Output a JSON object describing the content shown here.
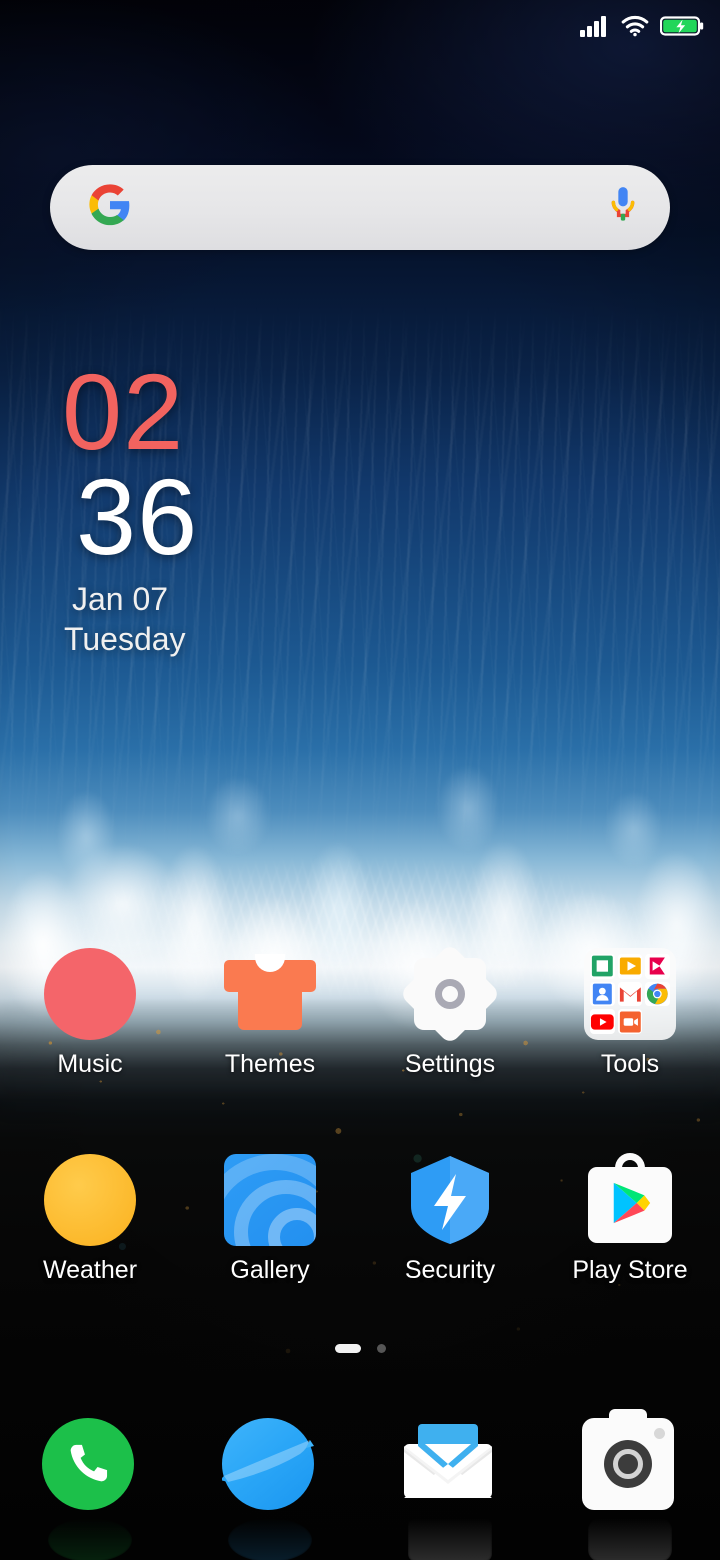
{
  "status_bar": {
    "signal_icon": "cellular-signal-icon",
    "signal_bars": 4,
    "wifi_icon": "wifi-icon",
    "battery_icon": "battery-charging-icon",
    "battery_color": "#22d65a",
    "charging": true
  },
  "search": {
    "google_logo": "google-g-icon",
    "query": "",
    "placeholder": "",
    "mic_icon": "microphone-icon"
  },
  "clock_widget": {
    "hours": "02",
    "minutes": "36",
    "date": "Jan 07",
    "weekday": "Tuesday",
    "hours_color": "#f2635f",
    "minutes_color": "#ffffff"
  },
  "home_grid": {
    "rows": [
      {
        "apps": [
          {
            "label": "Music",
            "icon": "music-note-icon",
            "color": "#f4656a"
          },
          {
            "label": "Themes",
            "icon": "tshirt-icon",
            "color": "#fa7a50"
          },
          {
            "label": "Settings",
            "icon": "gear-icon",
            "color": "#fafafa"
          },
          {
            "label": "Tools",
            "icon": "folder-icon",
            "color": "#fafafa"
          }
        ]
      },
      {
        "apps": [
          {
            "label": "Weather",
            "icon": "sun-icon",
            "color": "#fcb92c"
          },
          {
            "label": "Gallery",
            "icon": "photos-icon",
            "color": "#2e9cf5"
          },
          {
            "label": "Security",
            "icon": "shield-bolt-icon",
            "color": "#2e9cf5"
          },
          {
            "label": "Play Store",
            "icon": "play-store-icon",
            "color": "#ffffff"
          }
        ]
      }
    ]
  },
  "tools_folder": {
    "label": "Tools",
    "mini_apps": [
      {
        "icon": "sheets-icon",
        "color": "#21a366"
      },
      {
        "icon": "play-movies-icon",
        "color": "#f9ab00"
      },
      {
        "icon": "play-music-icon",
        "color": "#e8004c"
      },
      {
        "icon": "contacts-icon",
        "color": "#4285f4"
      },
      {
        "icon": "gmail-icon",
        "color": "#ea4335"
      },
      {
        "icon": "chrome-icon",
        "color": "#4285f4"
      },
      {
        "icon": "youtube-icon",
        "color": "#ff0000"
      },
      {
        "icon": "duo-video-icon",
        "color": "#f4622f"
      }
    ]
  },
  "page_indicator": {
    "total_pages": 2,
    "active_page": 1
  },
  "dock": {
    "apps": [
      {
        "label": "Phone",
        "icon": "phone-icon",
        "color": "#1cc04a"
      },
      {
        "label": "Browser",
        "icon": "browser-icon",
        "color": "#2aa6f7"
      },
      {
        "label": "Email",
        "icon": "envelope-icon",
        "color": "#3fb0ef"
      },
      {
        "label": "Camera",
        "icon": "camera-icon",
        "color": "#fbfbfb"
      }
    ]
  },
  "wallpaper": {
    "description": "ocean-wave-aerial",
    "deep_water_color": "#0a2348",
    "foam_color": "#f3f7fa",
    "rock_color": "#070707"
  }
}
